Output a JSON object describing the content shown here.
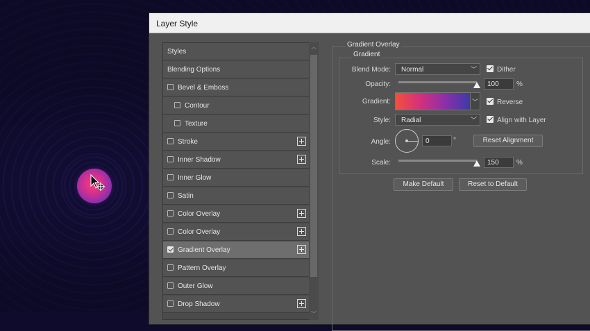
{
  "dialog": {
    "title": "Layer Style"
  },
  "styles_list": {
    "header": "Styles",
    "items": [
      {
        "label": "Blending Options",
        "checkbox": false,
        "checked": false,
        "plus": false,
        "indent": false
      },
      {
        "label": "Bevel & Emboss",
        "checkbox": true,
        "checked": false,
        "plus": false,
        "indent": false
      },
      {
        "label": "Contour",
        "checkbox": true,
        "checked": false,
        "plus": false,
        "indent": true
      },
      {
        "label": "Texture",
        "checkbox": true,
        "checked": false,
        "plus": false,
        "indent": true
      },
      {
        "label": "Stroke",
        "checkbox": true,
        "checked": false,
        "plus": true,
        "indent": false
      },
      {
        "label": "Inner Shadow",
        "checkbox": true,
        "checked": false,
        "plus": true,
        "indent": false
      },
      {
        "label": "Inner Glow",
        "checkbox": true,
        "checked": false,
        "plus": false,
        "indent": false
      },
      {
        "label": "Satin",
        "checkbox": true,
        "checked": false,
        "plus": false,
        "indent": false
      },
      {
        "label": "Color Overlay",
        "checkbox": true,
        "checked": false,
        "plus": true,
        "indent": false
      },
      {
        "label": "Color Overlay",
        "checkbox": true,
        "checked": false,
        "plus": true,
        "indent": false
      },
      {
        "label": "Gradient Overlay",
        "checkbox": true,
        "checked": true,
        "plus": true,
        "indent": false,
        "selected": true
      },
      {
        "label": "Pattern Overlay",
        "checkbox": true,
        "checked": false,
        "plus": false,
        "indent": false
      },
      {
        "label": "Outer Glow",
        "checkbox": true,
        "checked": false,
        "plus": false,
        "indent": false
      },
      {
        "label": "Drop Shadow",
        "checkbox": true,
        "checked": false,
        "plus": true,
        "indent": false
      }
    ]
  },
  "gradient_overlay": {
    "group_title": "Gradient Overlay",
    "subgroup_title": "Gradient",
    "blend_mode_label": "Blend Mode:",
    "blend_mode_value": "Normal",
    "dither_label": "Dither",
    "dither_checked": true,
    "opacity_label": "Opacity:",
    "opacity_value": "100",
    "opacity_unit": "%",
    "opacity_fraction": 1.0,
    "gradient_label": "Gradient:",
    "gradient_colors": [
      "#f2503c",
      "#d3307e",
      "#8b30a8",
      "#3d3aa8"
    ],
    "reverse_label": "Reverse",
    "reverse_checked": true,
    "style_label": "Style:",
    "style_value": "Radial",
    "align_label": "Align with Layer",
    "align_checked": true,
    "angle_label": "Angle:",
    "angle_value": "0",
    "angle_unit": "°",
    "reset_alignment_label": "Reset Alignment",
    "scale_label": "Scale:",
    "scale_value": "150",
    "scale_unit": "%",
    "scale_fraction": 1.0
  },
  "footer_buttons": {
    "make_default": "Make Default",
    "reset_default": "Reset to Default"
  },
  "colors": {
    "background": "#120e34",
    "panel": "#535353",
    "selected_row": "#6e6e6e"
  }
}
